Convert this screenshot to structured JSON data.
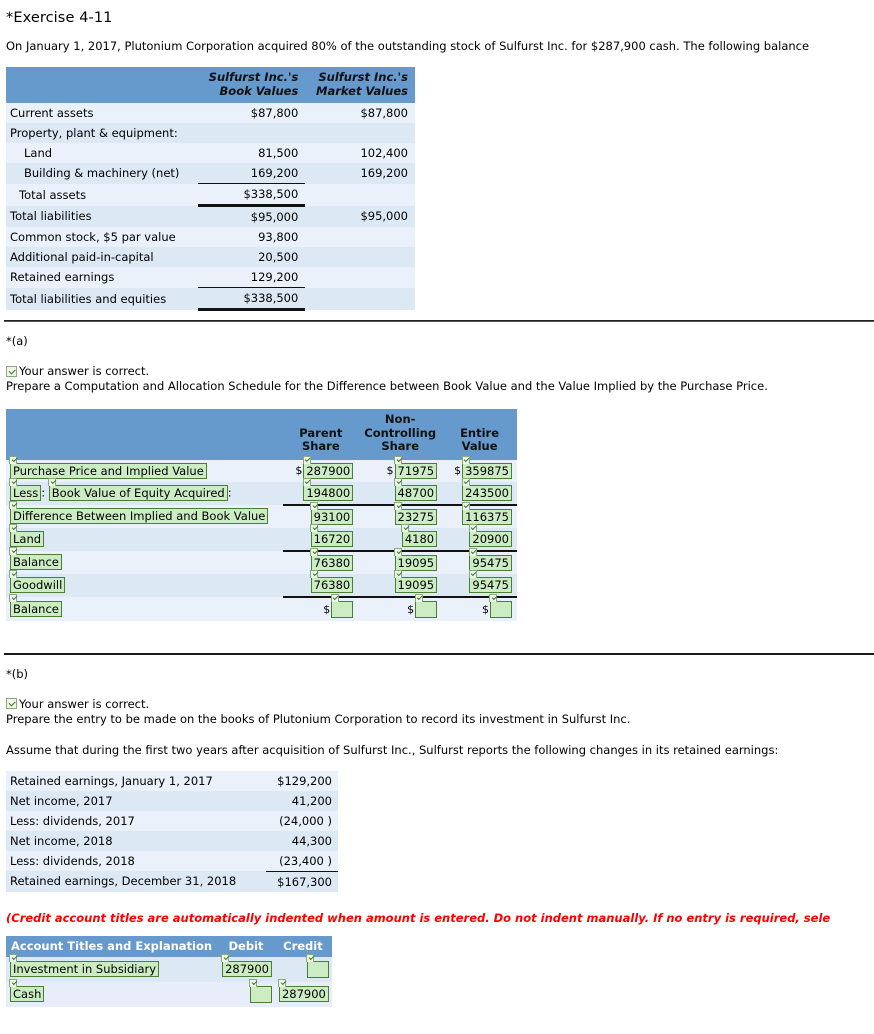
{
  "exercise": {
    "title": "*Exercise 4-11",
    "intro": "On January 1, 2017, Plutonium Corporation acquired 80% of the outstanding stock of Sulfurst Inc. for $287,900 cash. The following balance"
  },
  "balance_sheet": {
    "headers": [
      "",
      "Sulfurst Inc.'s\nBook Values",
      "Sulfurst Inc.'s\nMarket Values"
    ],
    "rows": [
      {
        "label": "Current assets",
        "book": "$87,800",
        "market": "$87,800"
      },
      {
        "label": "Property, plant & equipment:",
        "book": "",
        "market": ""
      },
      {
        "label": "Land",
        "book": "81,500",
        "market": "102,400"
      },
      {
        "label": "Building & machinery (net)",
        "book": "169,200",
        "market": "169,200"
      },
      {
        "label": "Total assets",
        "book": "$338,500",
        "market": ""
      },
      {
        "label": "Total liabilities",
        "book": "$95,000",
        "market": "$95,000"
      },
      {
        "label": "Common stock, $5 par value",
        "book": "93,800",
        "market": ""
      },
      {
        "label": "Additional paid-in-capital",
        "book": "20,500",
        "market": ""
      },
      {
        "label": "Retained earnings",
        "book": "129,200",
        "market": ""
      },
      {
        "label": "Total liabilities and equities",
        "book": "$338,500",
        "market": ""
      }
    ]
  },
  "part_a": {
    "label": "*(a)",
    "status": "Your answer is correct.",
    "instruction": "Prepare a Computation and Allocation Schedule for the Difference between Book Value and the Value Implied by the Purchase Price.",
    "headers": [
      "",
      "Parent\nShare",
      "Non-\nControlling\nShare",
      "Entire\nValue"
    ],
    "rows": [
      {
        "label": "Purchase Price and Implied Value",
        "label2": "",
        "dollar": true,
        "parent": "287900",
        "nci": "71975",
        "entire": "359875"
      },
      {
        "label": "Less",
        "label2": "Book Value of Equity Acquired",
        "dollar": false,
        "parent": "194800",
        "nci": "48700",
        "entire": "243500"
      },
      {
        "label": "Difference Between Implied and Book Value",
        "label2": "",
        "dollar": false,
        "parent": "93100",
        "nci": "23275",
        "entire": "116375"
      },
      {
        "label": "Land",
        "label2": "",
        "dollar": false,
        "parent": "16720",
        "nci": "4180",
        "entire": "20900"
      },
      {
        "label": "Balance",
        "label2": "",
        "dollar": false,
        "parent": "76380",
        "nci": "19095",
        "entire": "95475"
      },
      {
        "label": "Goodwill",
        "label2": "",
        "dollar": false,
        "parent": "76380",
        "nci": "19095",
        "entire": "95475"
      },
      {
        "label": "Balance",
        "label2": "",
        "dollar": true,
        "parent": "",
        "nci": "",
        "entire": ""
      }
    ],
    "dollar_sign": "$"
  },
  "part_b": {
    "label": "*(b)",
    "status": "Your answer is correct.",
    "instruction": "Prepare the entry to be made on the books of Plutonium Corporation to record its investment in Sulfurst Inc.",
    "assume": "Assume that during the first two years after acquisition of Sulfurst Inc., Sulfurst reports the following changes in its retained earnings:",
    "retained_earnings": [
      {
        "label": "Retained earnings, January 1, 2017",
        "value": "$129,200",
        "rule": false
      },
      {
        "label": "Net income, 2017",
        "value": "41,200",
        "rule": false
      },
      {
        "label": "Less: dividends, 2017",
        "value": "(24,000 )",
        "rule": false
      },
      {
        "label": "Net income, 2018",
        "value": "44,300",
        "rule": false
      },
      {
        "label": "Less: dividends, 2018",
        "value": "(23,400 )",
        "rule": false
      },
      {
        "label": "Retained earnings, December 31, 2018",
        "value": "$167,300",
        "rule": true
      }
    ],
    "red_note": "(Credit account titles are automatically indented when amount is entered. Do not indent manually. If no entry is required, sele",
    "journal": {
      "headers": [
        "Account Titles and Explanation",
        "Debit",
        "Credit"
      ],
      "rows": [
        {
          "account": "Investment in Subsidiary",
          "debit": "287900",
          "credit": ""
        },
        {
          "account": "Cash",
          "debit": "",
          "credit": "287900"
        }
      ]
    }
  },
  "colors": {
    "header_blue": "#6699cc",
    "row_light": "#eaf1fa",
    "row_alt": "#dde8f5",
    "field_green_bg": "#ccedc3",
    "field_green_border": "#4a7d35",
    "red": "#ff0000"
  }
}
